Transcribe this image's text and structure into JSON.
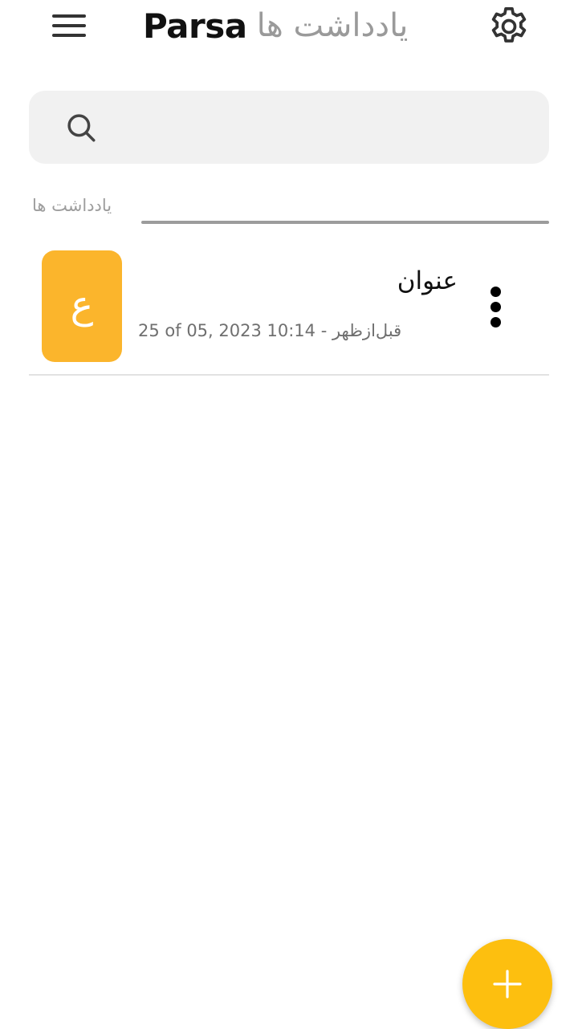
{
  "header": {
    "brand": "Parsa",
    "subtitle": "یادداشت ها",
    "menu_icon": "hamburger-menu-icon",
    "settings_icon": "gear-icon"
  },
  "search": {
    "value": "",
    "icon": "search-icon"
  },
  "section": {
    "label": "یادداشت ها"
  },
  "notes": [
    {
      "avatar_letter": "ع",
      "title": "عنوان",
      "date": "25 of 05, 2023 10:14 - قبل‌ازظهر",
      "avatar_color": "#fbb52c",
      "more_icon": "more-vertical-icon"
    }
  ],
  "fab": {
    "icon": "plus-icon"
  },
  "colors": {
    "accent": "#fdbf0f",
    "avatar": "#fbb52c",
    "search_bg": "#f1f1f1",
    "muted_text": "#9a9a9a"
  }
}
